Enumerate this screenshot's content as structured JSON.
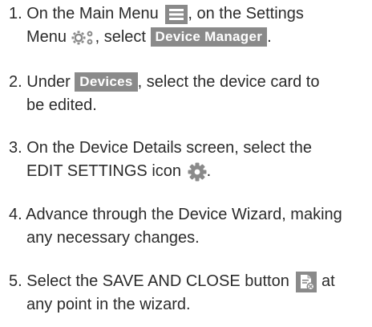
{
  "steps": [
    {
      "num": "1.",
      "t1": "On the Main Menu",
      "t2": ", on the Settings",
      "t3": "Menu",
      "t4": ", select",
      "badge": "Device Manager",
      "t5": ".",
      "icons": [
        "menu-icon",
        "settings-gears-icon"
      ]
    },
    {
      "num": "2.",
      "t1": "Under",
      "badge": "Devices",
      "t2": ", select the device card to",
      "t3": "be edited."
    },
    {
      "num": "3.",
      "t1": "On the Device Details screen, select the",
      "t2": "EDIT SETTINGS icon",
      "t3": ".",
      "icons": [
        "gear-icon"
      ]
    },
    {
      "num": "4.",
      "t1": "Advance through the Device Wizard, making",
      "t2": "any necessary changes."
    },
    {
      "num": "5.",
      "t1": "Select the SAVE AND CLOSE button",
      "t2": "at",
      "t3": "any point in the wizard.",
      "icons": [
        "save-and-close-icon"
      ]
    }
  ],
  "colors": {
    "text": "#2b2b2b",
    "badge_bg": "#8a8a8a",
    "badge_text": "#ffffff",
    "icon_gray": "#8a8a8a"
  }
}
